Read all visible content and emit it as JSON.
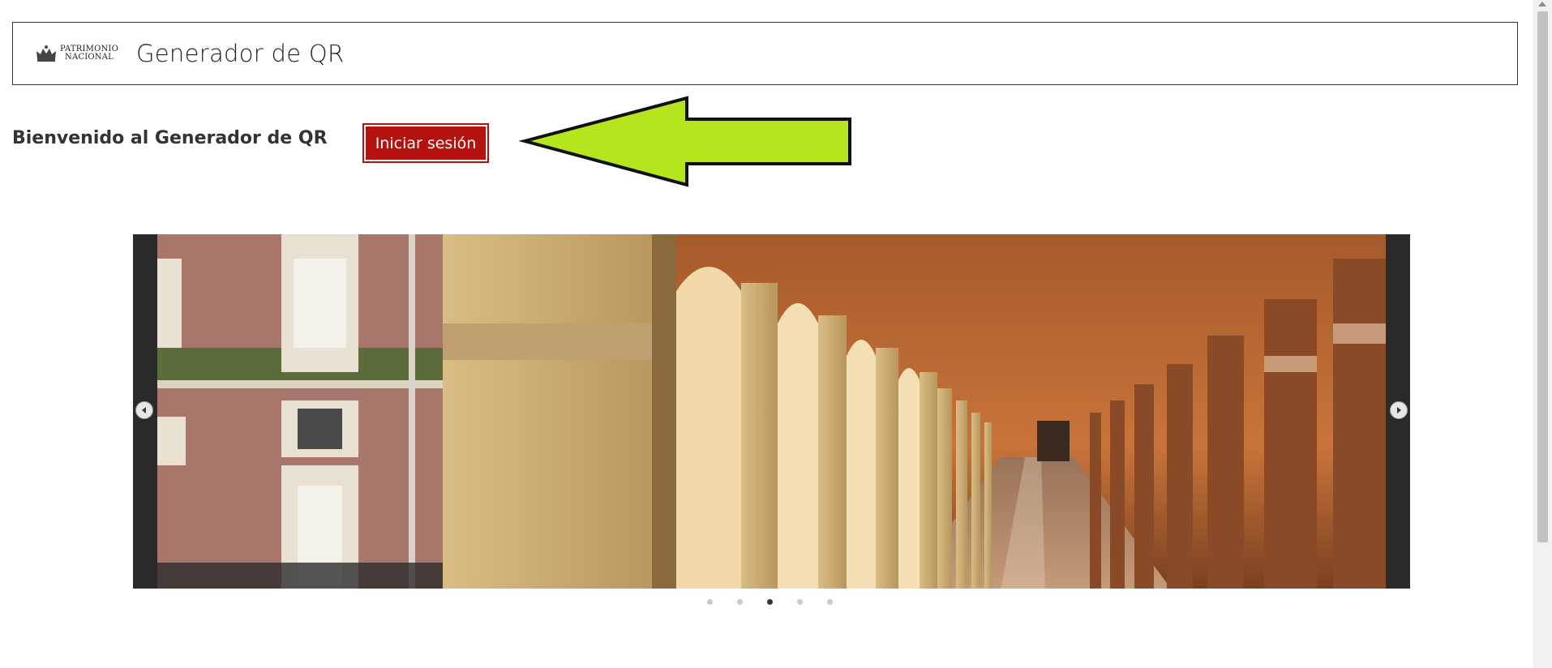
{
  "header": {
    "logo_line1": "PATRIMONIO",
    "logo_line2": "NACIONAL",
    "title": "Generador de QR"
  },
  "welcome": {
    "text": "Bienvenido al Generador de QR",
    "login_label": "Iniciar sesión"
  },
  "annotation": {
    "arrow_color": "#b5e61d"
  },
  "carousel": {
    "slides_count": 5,
    "active_index": 3
  },
  "colors": {
    "brand_red": "#b5120f",
    "accent_green": "#b5e61d"
  }
}
